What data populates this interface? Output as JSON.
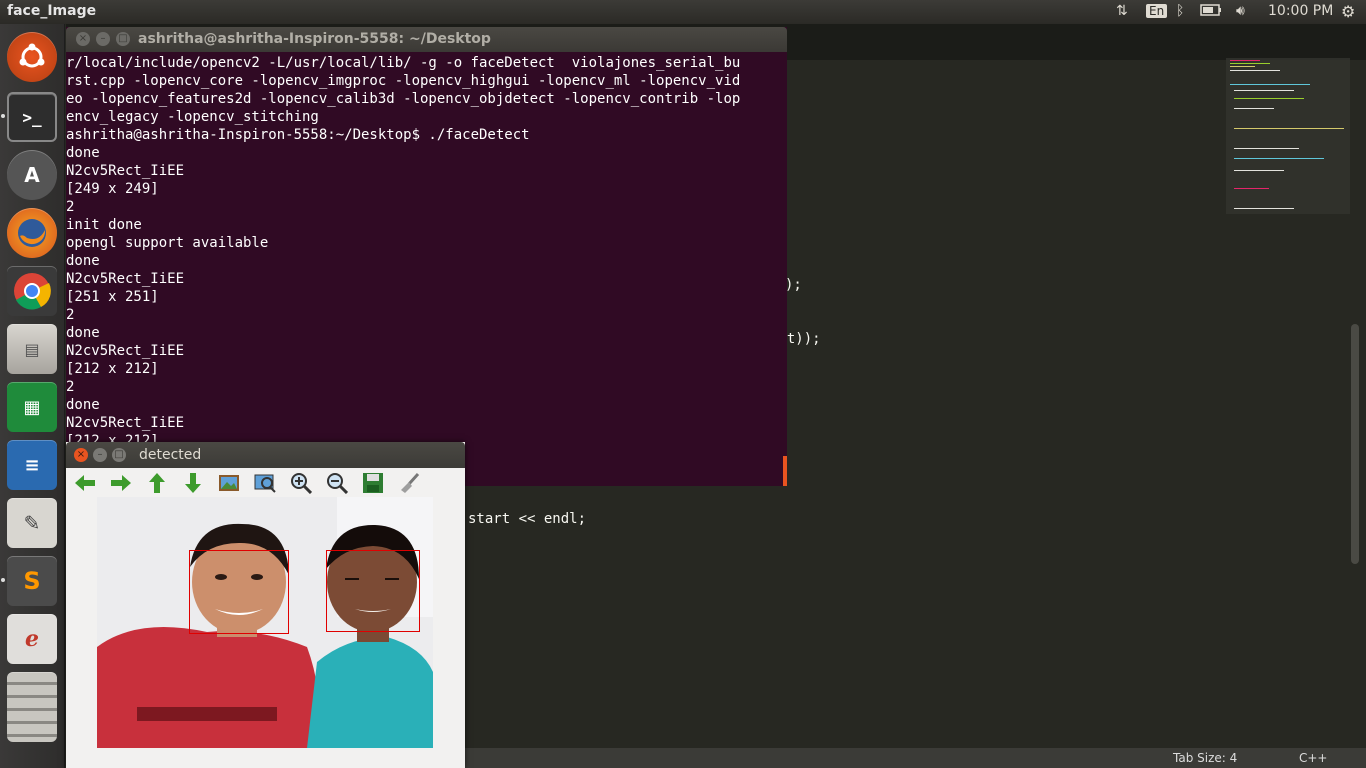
{
  "top_panel": {
    "app_title": "face_Image",
    "lang": "En",
    "time": "10:00 PM"
  },
  "icons": [
    "ubuntu-logo-icon",
    "terminal-icon",
    "software-updater-icon",
    "firefox-icon",
    "chrome-icon",
    "files-icon",
    "calc-icon",
    "writer-icon",
    "text-editor-icon",
    "sublime-icon",
    "evince-icon",
    "network-icon",
    "bluetooth-icon",
    "battery-icon",
    "volume-icon",
    "gear-icon"
  ],
  "terminal": {
    "title": "ashritha@ashritha-Inspiron-5558: ~/Desktop",
    "lines": [
      "r/local/include/opencv2 -L/usr/local/lib/ -g -o faceDetect  violajones_serial_bu",
      "rst.cpp -lopencv_core -lopencv_imgproc -lopencv_highgui -lopencv_ml -lopencv_vid",
      "eo -lopencv_features2d -lopencv_calib3d -lopencv_objdetect -lopencv_contrib -lop",
      "encv_legacy -lopencv_stitching",
      "ashritha@ashritha-Inspiron-5558:~/Desktop$ ./faceDetect",
      "done",
      "N2cv5Rect_IiEE",
      "[249 x 249]",
      "2",
      "init done",
      "opengl support available",
      "done",
      "N2cv5Rect_IiEE",
      "[251 x 251]",
      "2",
      "done",
      "N2cv5Rect_IiEE",
      "[212 x 212]",
      "2",
      "done",
      "N2cv5Rect_IiEE",
      "[212 x 212]"
    ]
  },
  "editor": {
    "code_fragments": [
      ");",
      "ght));",
      "start << endl;"
    ],
    "status": {
      "tab_size": "Tab Size: 4",
      "syntax": "C++"
    }
  },
  "detected_window": {
    "title": "detected",
    "toolbar": [
      "back-arrow-icon",
      "forward-arrow-icon",
      "up-arrow-icon",
      "down-arrow-icon",
      "image-icon",
      "zoom-fit-icon",
      "zoom-in-icon",
      "zoom-out-icon",
      "save-icon",
      "clear-icon"
    ],
    "colors": {
      "face_box": "#e00000"
    }
  }
}
